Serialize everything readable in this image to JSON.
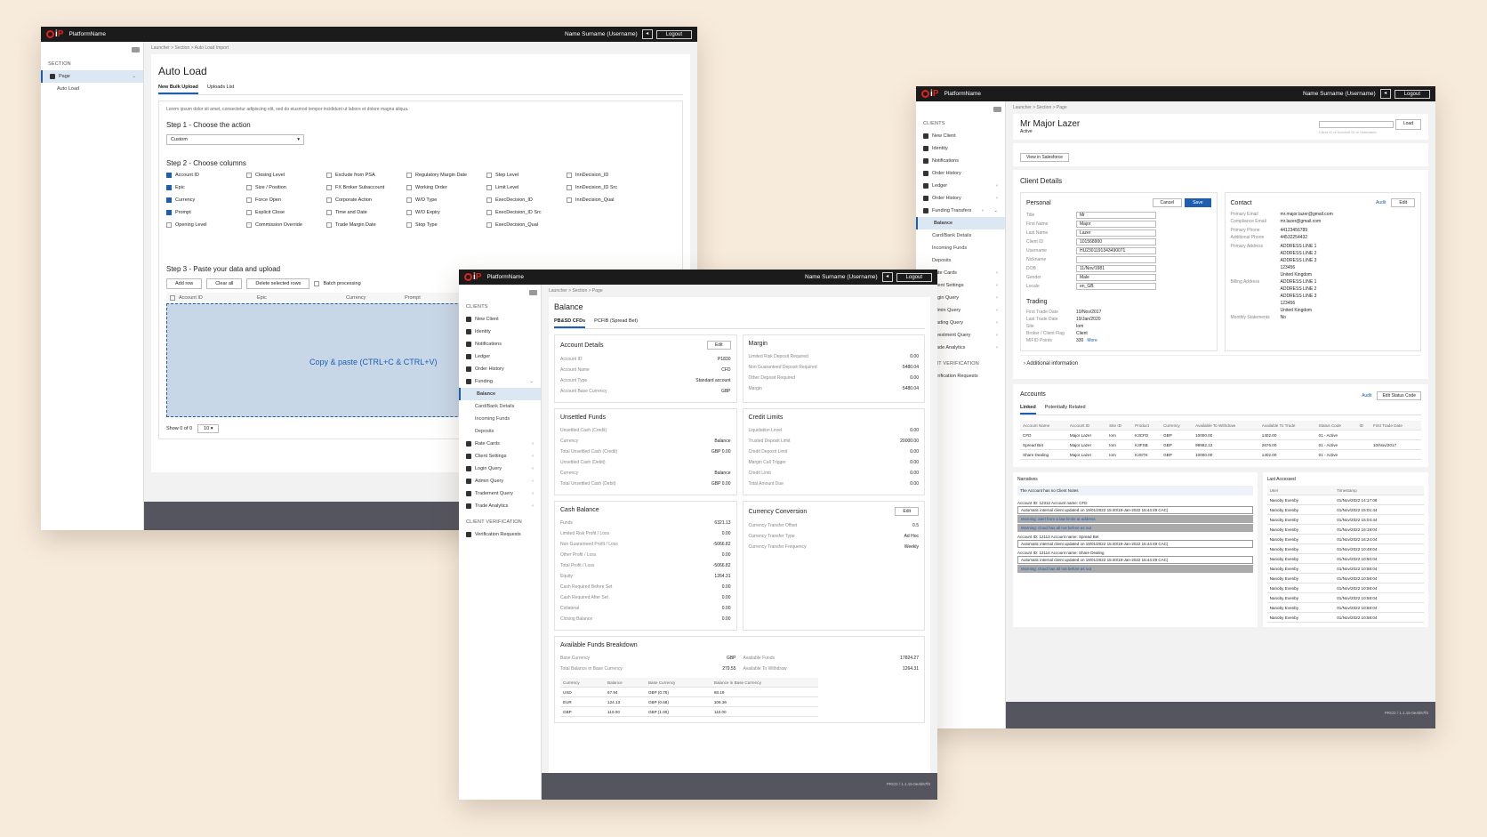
{
  "common": {
    "platform_name": "PlatformName",
    "user": "Name Surname (Username)",
    "logout": "Logout",
    "version": "PRCD / 1.1.15-0e4b67f0"
  },
  "autoload": {
    "section_label": "SECTION",
    "nav_page": "Page",
    "nav_sub": "Auto Load",
    "breadcrumb": "Launcher > Section > Auto Load Import",
    "title": "Auto Load",
    "tabs": [
      "New Bulk Upload",
      "Uploads List"
    ],
    "intro": "Lorem ipsum dolor sit amet, consectetur adipiscing elit, sed do eiusmod tempor incididunt ut labore et dolore magna aliqua.",
    "step1": "Step 1 - Choose the action",
    "action_value": "Custom",
    "step2": "Step 2 - Choose columns",
    "columns": [
      {
        "label": "Account ID",
        "on": true
      },
      {
        "label": "Closing Level",
        "on": false
      },
      {
        "label": "Exclude from PSA",
        "on": false
      },
      {
        "label": "Regulatory Margin Date",
        "on": false
      },
      {
        "label": "Step Level",
        "on": false
      },
      {
        "label": "InnDecision_ID",
        "on": false
      },
      {
        "label": "Epic",
        "on": true
      },
      {
        "label": "Size / Position",
        "on": false
      },
      {
        "label": "FX Broker Subaccount",
        "on": false
      },
      {
        "label": "Working Order",
        "on": false
      },
      {
        "label": "Limit Level",
        "on": false
      },
      {
        "label": "InnDecision_ID Src",
        "on": false
      },
      {
        "label": "Currency",
        "on": true
      },
      {
        "label": "Force Open",
        "on": false
      },
      {
        "label": "Corporate Action",
        "on": false
      },
      {
        "label": "W/O Type",
        "on": false
      },
      {
        "label": "ExecDecision_ID",
        "on": false
      },
      {
        "label": "InnDecision_Qual",
        "on": false
      },
      {
        "label": "Prompt",
        "on": true
      },
      {
        "label": "Explicit Close",
        "on": false
      },
      {
        "label": "Time and Date",
        "on": false
      },
      {
        "label": "W/O Expiry",
        "on": false
      },
      {
        "label": "ExecDecision_ID Src",
        "on": false
      },
      {
        "label": "",
        "on": null
      },
      {
        "label": "Opening Level",
        "on": false
      },
      {
        "label": "Commission Override",
        "on": false
      },
      {
        "label": "Trade Margin Date",
        "on": false
      },
      {
        "label": "Stop Type",
        "on": false
      },
      {
        "label": "ExecDecision_Qual",
        "on": false
      },
      {
        "label": "",
        "on": null
      }
    ],
    "step3": "Step 3 - Paste your data and upload",
    "btn_add": "Add row",
    "btn_clear": "Clear all",
    "btn_delete": "Delete selected rows",
    "batch": "Batch processing",
    "headers": [
      "Account ID",
      "Epic",
      "Currency",
      "Prompt"
    ],
    "paste_hint": "Copy & paste (CTRL+C  &  CTRL+V)",
    "show": "Show 0 of 0",
    "page_size": "10"
  },
  "balance": {
    "breadcrumb": "Launcher > Section > Page",
    "clients_label": "CLIENTS",
    "nav": [
      "New Client",
      "Identity",
      "Notifications",
      "Ledger",
      "Order History",
      "Funding"
    ],
    "nav_sub": [
      "Balance",
      "Card/Bank Details",
      "Incoming Funds",
      "Deposits"
    ],
    "nav2": [
      "Rate Cards",
      "Client Settings",
      "Login Query",
      "Admin Query",
      "Tradement Query",
      "Trade Analytics"
    ],
    "verif_label": "CLIENT VERIFICATION",
    "verif_item": "Verification Requests",
    "title": "Balance",
    "tabs": [
      "PB&SD CFDs",
      "PCFIB (Spread Bet)"
    ],
    "account_details": {
      "title": "Account Details",
      "edit": "Edit",
      "rows": [
        [
          "Account ID",
          "P1830"
        ],
        [
          "Account Name",
          "CFD"
        ],
        [
          "Account Type",
          "Standard account"
        ],
        [
          "Account Base Currency",
          "GBP"
        ]
      ]
    },
    "margin": {
      "title": "Margin",
      "rows": [
        [
          "Limited Risk Deposit Required",
          "0.00"
        ],
        [
          "Non Guaranteed Deposit Required",
          "5480.04"
        ],
        [
          "Other Deposit Required",
          "0.00"
        ],
        [
          "Margin",
          "5480.04"
        ]
      ]
    },
    "unsettled": {
      "title": "Unsettled Funds",
      "rows": [
        [
          "Unsettled Cash (Credit)",
          ""
        ],
        [
          "Currency",
          "Balance"
        ],
        [
          "Total Unsettled Cash (Credit)",
          "GBP 0.00"
        ],
        [
          "Unsettled Cash (Debit)",
          ""
        ],
        [
          "Currency",
          "Balance"
        ],
        [
          "Total Unsettled Cash (Debit)",
          "GBP 0.00"
        ]
      ]
    },
    "credit": {
      "title": "Credit Limits",
      "rows": [
        [
          "Liquidation Level",
          "0.00"
        ],
        [
          "Trusted Deposit Limit",
          "20000.00"
        ],
        [
          "Credit Deposit Limit",
          "0.00"
        ],
        [
          "Margin Call Trigger",
          "0.00"
        ],
        [
          "Credit Limit",
          "0.00"
        ],
        [
          "Total Amount Due",
          "0.00"
        ]
      ]
    },
    "cash": {
      "title": "Cash Balance",
      "rows": [
        [
          "Funds",
          "6321.13"
        ],
        [
          "Limited Risk Profit / Loss",
          "0.00"
        ],
        [
          "Non Guaranteed Profit / Loss",
          "-5066.82"
        ],
        [
          "Other Profit / Loss",
          "0.00"
        ],
        [
          "Total Profit / Loss",
          "-5066.82"
        ],
        [
          "Equity",
          "1264.31"
        ],
        [
          "Cash Required Before Set",
          "0.00"
        ],
        [
          "Cash Required After Set",
          "0.00"
        ],
        [
          "Collateral",
          "0.00"
        ],
        [
          "Closing Balance",
          "0.00"
        ]
      ]
    },
    "conversion": {
      "title": "Currency Conversion",
      "edit": "Edit",
      "rows": [
        [
          "Currency Transfer Offset",
          "0.5"
        ],
        [
          "Currency Transfer Type",
          "Ad Hoc"
        ],
        [
          "Currency Transfer Frequency",
          "Weekly"
        ]
      ]
    },
    "afb": {
      "title": "Available Funds Breakdown",
      "rows": [
        [
          "Base Currency",
          "GBP",
          "Available Funds",
          "17824.27"
        ],
        [
          "Total Balance in Base Currency",
          "279.55",
          "Available To Withdraw",
          "1264.31"
        ]
      ],
      "headers": [
        "Currency",
        "Balance",
        "Base Currency",
        "Balance in Base Currency"
      ],
      "table": [
        [
          "USD",
          "67.94",
          "GBP (0.76)",
          "68.19"
        ],
        [
          "EUR",
          "124.13",
          "GBP (0.68)",
          "108.36"
        ],
        [
          "GBP",
          "110.00",
          "GBP (1.00)",
          "110.00"
        ]
      ]
    }
  },
  "client": {
    "breadcrumb": "Launcher > Section > Page",
    "clients_label": "CLIENTS",
    "nav": [
      "New Client",
      "Identity",
      "Notifications",
      "Order History",
      "Ledger",
      "Order History",
      "Funding Transfers"
    ],
    "nav_sub": [
      "Balance",
      "Card/Bank Details",
      "Incoming Funds",
      "Deposits"
    ],
    "nav2": [
      "Rate Cards",
      "Client Settings",
      "Login Query",
      "Admin Query",
      "Trading Query",
      "Investment Query",
      "Trade Analytics"
    ],
    "verif_label": "CLIENT VERIFICATION",
    "verif_item": "Verification Requests",
    "name": "Mr Major Lazer",
    "status": "Active",
    "load": "Load",
    "load_placeholder": "Client ID or Account ID or Username",
    "salesforce": "View in Salesforce",
    "details_title": "Client Details",
    "personal": "Personal",
    "cancel": "Cancel",
    "save": "Save",
    "personal_rows": [
      [
        "Title",
        "Mr"
      ],
      [
        "First Name",
        "Major"
      ],
      [
        "Last Name",
        "Lazer"
      ],
      [
        "Client ID",
        "101568900"
      ],
      [
        "Username",
        "HU2301191343490071"
      ],
      [
        "Nickname",
        ""
      ],
      [
        "DOB",
        "11/Nov/1981"
      ],
      [
        "Gender",
        "Male"
      ],
      [
        "Locale",
        "en_GB"
      ]
    ],
    "contact": "Contact",
    "audit": "Audit",
    "edit": "Edit",
    "contact_rows": [
      [
        "Primary Email",
        "mr.major.lazer@gmail.com"
      ],
      [
        "Compliance Email",
        "mr.lazer@gmail.com"
      ],
      [
        "",
        ""
      ],
      [
        "Primary Phone",
        "44123456789"
      ],
      [
        "Additional Phone",
        "44532254432"
      ],
      [
        "",
        ""
      ],
      [
        "Primary Address",
        "ADDRESS LINE 1"
      ],
      [
        "",
        "ADDRESS LINE 2"
      ],
      [
        "",
        "ADDRESS LINE 3"
      ],
      [
        "",
        "123456"
      ],
      [
        "",
        "United Kingdom"
      ],
      [
        "Billing Address",
        "ADDRESS LINE 1"
      ],
      [
        "",
        "ADDRESS LINE 2"
      ],
      [
        "",
        "ADDRESS LINE 3"
      ],
      [
        "",
        "123456"
      ],
      [
        "",
        "United Kingdom"
      ],
      [
        "Monthly Statements",
        "No"
      ]
    ],
    "trading": "Trading",
    "trading_rows": [
      [
        "First Trade Date",
        "10/Nov/2017"
      ],
      [
        "Last Trade Date",
        "19/Jan/2020"
      ],
      [
        "Site",
        "Iom"
      ],
      [
        "Broker / Client Flag",
        "Client"
      ],
      [
        "MIFID Points",
        "330"
      ]
    ],
    "more": "More",
    "additional": "Additional information",
    "accounts": "Accounts",
    "edit_status": "Edit Status Code",
    "acc_tabs": [
      "Linked",
      "Potentially Related"
    ],
    "acc_headers": [
      "Account Name",
      "Account ID",
      "Site ID",
      "Product",
      "Currency",
      "Available To Withdraw",
      "Available To Trade",
      "Status Code",
      "ID",
      "First Trade Date"
    ],
    "acc_rows": [
      [
        "CFD",
        "Major Lazer",
        "Iom",
        "K3CFD",
        "GBP",
        "10000.00",
        "1402.00",
        "01 - Active",
        "",
        ""
      ],
      [
        "Spread Bet",
        "Major Lazer",
        "Iom",
        "K3FSB",
        "GBP",
        "99982.12",
        "2676.00",
        "01 - Active",
        "",
        "10/Nov/2017"
      ],
      [
        "Share Dealing",
        "Major Lazer",
        "Iom",
        "K3STK",
        "GBP",
        "10000.00",
        "1402.00",
        "01 - Active",
        "",
        ""
      ]
    ],
    "narratives": "Narratives",
    "no_notes": "The Account has no Client Notes",
    "nar_groups": [
      {
        "head": "Account ID: 12312    Account name: CFD",
        "lines": [
          "Automatic internal client updated on 19/01/2022 15:40/19-Jan-2022 15:44:49 CAC)",
          "Warning: alert from a law limits at address",
          "Warning: cloud has all not before as out"
        ]
      },
      {
        "head": "Account ID: 12113    Account name: Spread Bet",
        "lines": [
          "Automatic internal client updated on 19/01/2022 15:40/19-Jan-2022 15:44:49 CAC)"
        ]
      },
      {
        "head": "Account ID: 12114    Account name: Share Dealing",
        "lines": [
          "Automatic internal client updated on 19/01/2022 15:40/19-Jan-2022 15:44:49 CAC)",
          "Warning: cloud has all not before as out"
        ]
      }
    ],
    "last_accessed": "Last Accessed",
    "la_headers": [
      "User",
      "Timestamp"
    ],
    "la_rows": [
      [
        "Nanoby Evenby",
        "01/Nov/2022 14:17:08"
      ],
      [
        "Nanoby Evenby",
        "01/Nov/2022 15:01:44"
      ],
      [
        "Nanoby Evenby",
        "01/Nov/2022 15:04:44"
      ],
      [
        "Nanoby Evenby",
        "01/Nov/2022 16:19:04"
      ],
      [
        "Nanoby Evenby",
        "01/Nov/2022 16:24:04"
      ],
      [
        "Nanoby Evenby",
        "01/Nov/2022 10:48:04"
      ],
      [
        "Nanoby Evenby",
        "01/Nov/2022 10:50:04"
      ],
      [
        "Nanoby Evenby",
        "01/Nov/2022 10:58:04"
      ],
      [
        "Nanoby Evenby",
        "01/Nov/2022 10:58:04"
      ],
      [
        "Nanoby Evenby",
        "01/Nov/2022 10:58:04"
      ],
      [
        "Nanoby Evenby",
        "01/Nov/2022 10:58:04"
      ],
      [
        "Nanoby Evenby",
        "01/Nov/2022 10:58:04"
      ],
      [
        "Nanoby Evenby",
        "01/Nov/2022 10:58:04"
      ]
    ]
  }
}
